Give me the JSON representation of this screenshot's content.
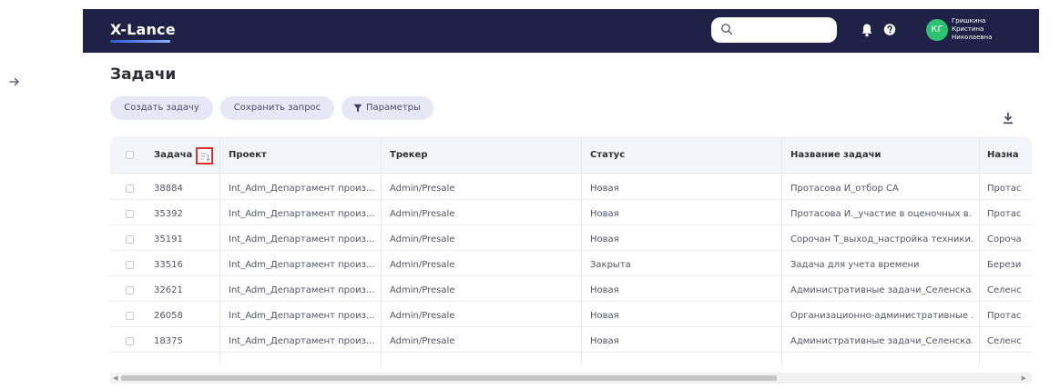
{
  "app": {
    "logo": "X-Lance",
    "user": {
      "initials": "КГ",
      "surname": "Гришкина",
      "first_name": "Кристина",
      "patronymic": "Николаевна"
    }
  },
  "page": {
    "title": "Задачи"
  },
  "toolbar": {
    "create_label": "Создать задачу",
    "save_label": "Сохранить запрос",
    "params_label": "Параметры"
  },
  "table": {
    "columns": [
      "Задача",
      "Проект",
      "Трекер",
      "Статус",
      "Название задачи",
      "Назна"
    ],
    "rows": [
      [
        "38884",
        "Int_Adm_Департамент произ...",
        "Admin/Presale",
        "Новая",
        "Протасова И_отбор СА",
        "Протас"
      ],
      [
        "35392",
        "Int_Adm_Департамент произ...",
        "Admin/Presale",
        "Новая",
        "Протасова И._участие в оценочных в...",
        "Протас"
      ],
      [
        "35191",
        "Int_Adm_Департамент произ...",
        "Admin/Presale",
        "Новая",
        "Сорочан Т_выход_настройка техники...",
        "Сороча"
      ],
      [
        "33516",
        "Int_Adm_Департамент произ...",
        "Admin/Presale",
        "Закрыта",
        "Задача для учета времени",
        "Берези"
      ],
      [
        "32621",
        "Int_Adm_Департамент произ...",
        "Admin/Presale",
        "Новая",
        "Административные задачи_Селенска...",
        "Селенс"
      ],
      [
        "26058",
        "Int_Adm_Департамент произ...",
        "Admin/Presale",
        "Новая",
        "Организационно-административные ...",
        "Протас"
      ],
      [
        "18375",
        "Int_Adm_Департамент произ...",
        "Admin/Presale",
        "Новая",
        "Административные задачи_Селенска...",
        "Селенс"
      ]
    ]
  },
  "icons": {
    "search": "search-icon",
    "bell": "bell-icon",
    "help": "help-icon",
    "sidebar_toggle": "arrow-right-icon",
    "filter": "filter-icon",
    "download": "download-icon",
    "sort": "sort-icon"
  },
  "colors": {
    "topbar": "#1f2246",
    "avatar": "#2bc36e",
    "button_bg": "#e6e8f6",
    "header_bg": "#f4f5fb",
    "highlight": "#e03030"
  }
}
